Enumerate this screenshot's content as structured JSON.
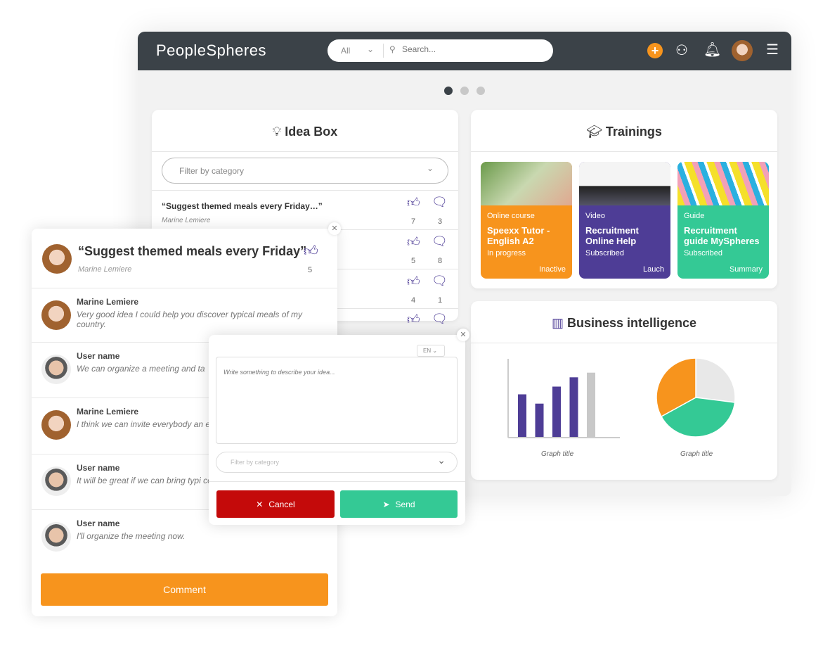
{
  "header": {
    "logo": "PeopleSpheres",
    "search_scope": "All",
    "search_placeholder": "Search...",
    "icons": [
      "plus-icon",
      "users-icon",
      "bell-icon",
      "avatar",
      "menu-icon"
    ]
  },
  "carousel": {
    "pages": 3,
    "active": 1
  },
  "idea_box": {
    "title": "Idea Box",
    "filter_placeholder": "Filter by category",
    "ideas": [
      {
        "title": "“Suggest themed meals every Friday…”",
        "author": "Marine Lemiere",
        "likes": "7",
        "comments": "3"
      },
      {
        "likes": "5",
        "comments": "8"
      },
      {
        "likes": "4",
        "comments": "1"
      },
      {
        "likes": "",
        "comments": ""
      }
    ]
  },
  "trainings": {
    "title": "Trainings",
    "items": [
      {
        "type": "Online course",
        "name": "Speexx Tutor - English A2",
        "status": "In progress",
        "action": "Inactive",
        "color": "#f7941d"
      },
      {
        "type": "Video",
        "name": "Recruitment Online Help",
        "status": "Subscribed",
        "action": "Lauch",
        "color": "#4e3d96"
      },
      {
        "type": "Guide",
        "name": "Recruitment guide MySpheres",
        "status": "Subscribed",
        "action": "Summary",
        "color": "#34c995"
      }
    ]
  },
  "bi": {
    "title": "Business intelligence"
  },
  "chart_data": [
    {
      "type": "bar",
      "title": "Graph title",
      "values": [
        55,
        43,
        65,
        77,
        83
      ],
      "colors": [
        "#4e3d96",
        "#4e3d96",
        "#4e3d96",
        "#4e3d96",
        "#c8c8c8"
      ],
      "ylim": [
        0,
        100
      ]
    },
    {
      "type": "pie",
      "title": "Graph title",
      "values": [
        27,
        40,
        33
      ],
      "colors": [
        "#e8e8e8",
        "#34c995",
        "#f7941d"
      ]
    }
  ],
  "detail": {
    "title": "“Suggest themed meals every Friday”",
    "author": "Marine Lemiere",
    "likes": "5",
    "comment_button": "Comment",
    "comments": [
      {
        "name": "Marine Lemiere",
        "text": "Very good idea I could help you discover typical meals of my country.",
        "avatar": "female"
      },
      {
        "name": "User name",
        "text": "We can organize a meeting and ta",
        "avatar": "male"
      },
      {
        "name": "Marine Lemiere",
        "text": "I think we can invite everybody an event.",
        "avatar": "female"
      },
      {
        "name": "User name",
        "text": "It will be great if we can bring typi countries.",
        "avatar": "male"
      },
      {
        "name": "User name",
        "text": "I'll organize the meeting now.",
        "avatar": "male"
      }
    ]
  },
  "compose": {
    "lang": "EN",
    "placeholder": "Write something to describe your idea...",
    "category_placeholder": "Filter by category",
    "cancel": "Cancel",
    "send": "Send"
  },
  "colors": {
    "orange": "#f7941d",
    "purple": "#4e3d96",
    "green": "#34c995",
    "red": "#c40a0a",
    "dark": "#3b4248"
  }
}
